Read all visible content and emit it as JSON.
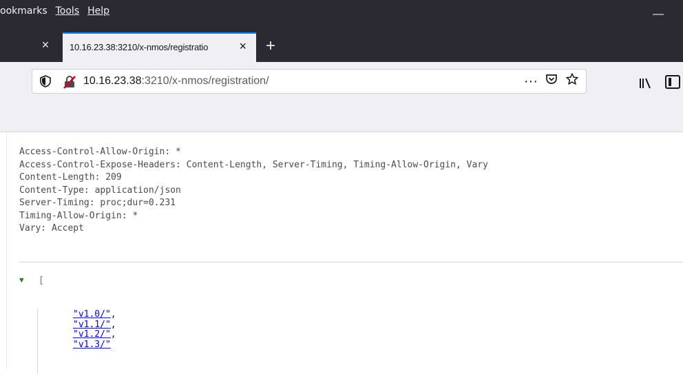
{
  "menubar": {
    "items": [
      {
        "label": "ookmarks"
      },
      {
        "label": "Tools"
      },
      {
        "label": "Help"
      }
    ],
    "minimize_label": "—"
  },
  "tabs": [
    {
      "title": "10.16.23.38:3210/x-nmos/registratio",
      "active": true
    }
  ],
  "tabbar": {
    "close_left": "×",
    "close_tab": "×",
    "new_tab": "+"
  },
  "urlbar": {
    "host": "10.16.23.38",
    "rest": ":3210/x-nmos/registration/",
    "more_label": "···"
  },
  "response_headers": [
    "Access-Control-Allow-Origin: *",
    "Access-Control-Expose-Headers: Content-Length, Server-Timing, Timing-Allow-Origin, Vary",
    "Content-Length: 209",
    "Content-Type: application/json",
    "Server-Timing: proc;dur=0.231",
    "Timing-Allow-Origin: *",
    "Vary: Accept"
  ],
  "json": {
    "toggle": "▼",
    "open_bracket": "[",
    "items": [
      "v1.0/",
      "v1.1/",
      "v1.2/",
      "v1.3/"
    ]
  },
  "colors": {
    "chrome_dark": "#2b2a33",
    "chrome_light": "#f0f0f4",
    "tab_accent": "#0a84ff",
    "link": "#0000ee",
    "toggle_green": "#2a7a2a"
  }
}
